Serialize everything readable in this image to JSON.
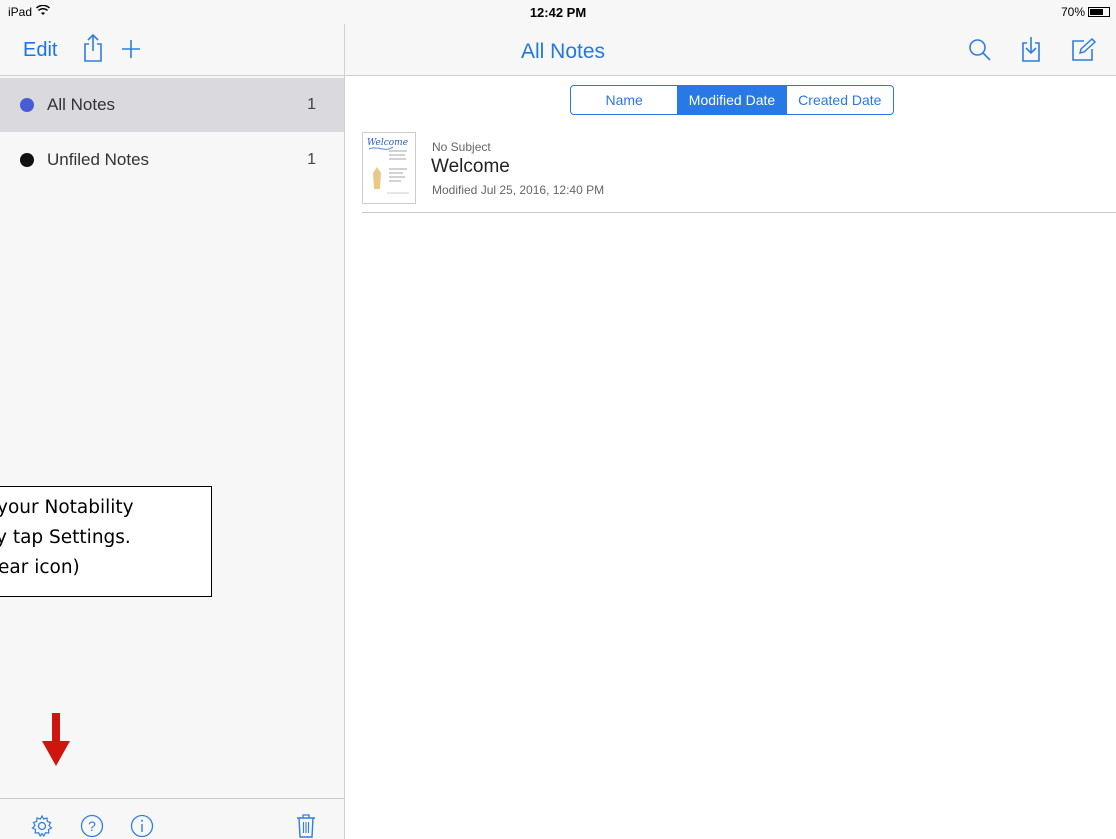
{
  "status_bar": {
    "device": "iPad",
    "time": "12:42 PM",
    "battery_text": "70%",
    "battery_level": 0.7
  },
  "nav": {
    "edit_label": "Edit",
    "title": "All Notes",
    "icons": [
      "share-icon",
      "add-icon",
      "search-icon",
      "import-icon",
      "compose-icon"
    ]
  },
  "sidebar": {
    "items": [
      {
        "label": "All Notes",
        "count": "1",
        "dot_color": "#4a5bd6",
        "selected": true
      },
      {
        "label": "Unfiled Notes",
        "count": "1",
        "dot_color": "#111111",
        "selected": false
      }
    ],
    "toolbar_icons": [
      "gear-icon",
      "help-icon",
      "info-icon",
      "trash-icon"
    ]
  },
  "sort": {
    "options": [
      "Name",
      "Modified Date",
      "Created Date"
    ],
    "selected": "Modified Date"
  },
  "notes": [
    {
      "subject": "No Subject",
      "title": "Welcome",
      "modified": "Modified Jul 25, 2016, 12:40 PM",
      "thumb_text": "Welcome"
    }
  ],
  "callout": {
    "lines": [
      "your Notability",
      "y tap Settings.",
      "ear icon)"
    ]
  },
  "colors": {
    "accent": "#2878e6",
    "arrow": "#d0150f"
  }
}
